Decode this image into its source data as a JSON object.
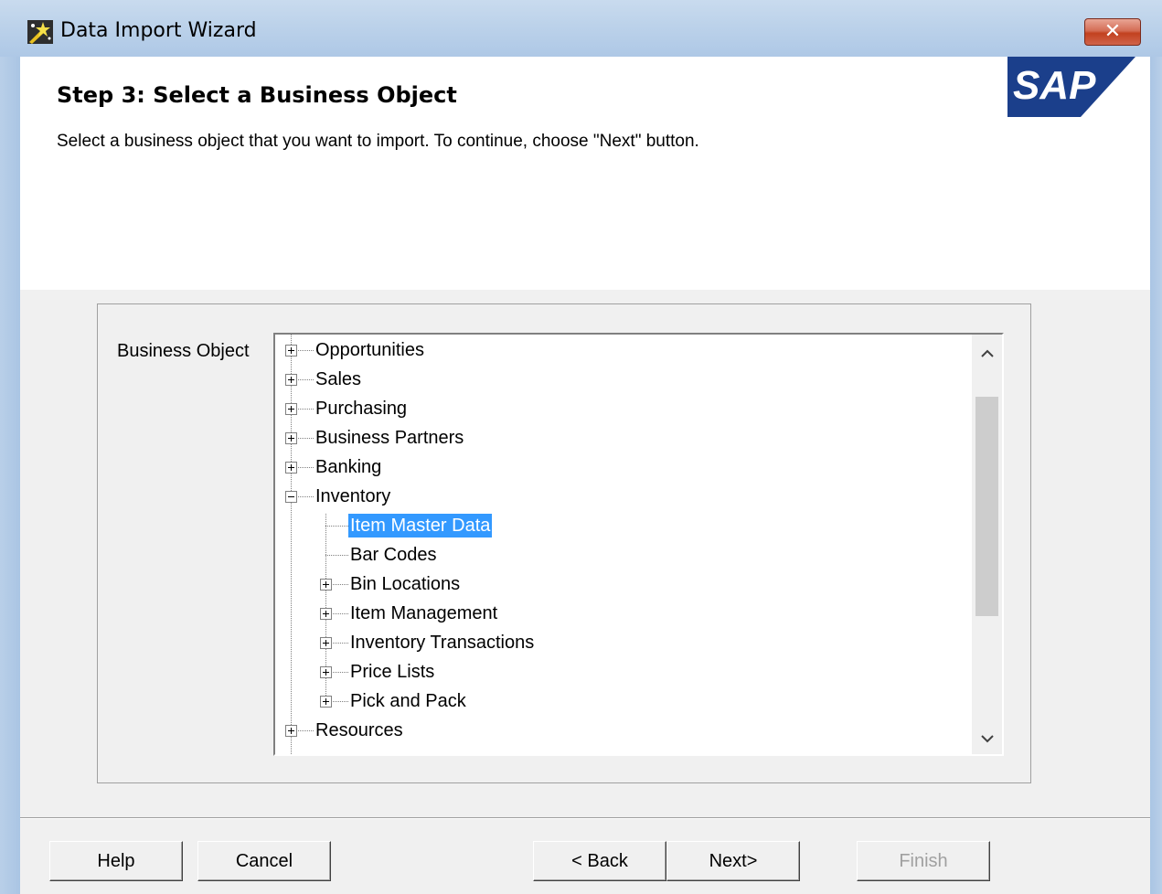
{
  "window": {
    "title": "Data Import Wizard",
    "close_label": "✕"
  },
  "header": {
    "step_title": "Step 3: Select a Business Object",
    "description": "Select a business object that you want to import. To continue, choose \"Next\" button.",
    "logo_text": "SAP"
  },
  "content": {
    "field_label": "Business Object",
    "tree": {
      "nodes": [
        {
          "label": "Opportunities",
          "state": "collapsed",
          "level": 0
        },
        {
          "label": "Sales",
          "state": "collapsed",
          "level": 0
        },
        {
          "label": "Purchasing",
          "state": "collapsed",
          "level": 0
        },
        {
          "label": "Business Partners",
          "state": "collapsed",
          "level": 0
        },
        {
          "label": "Banking",
          "state": "collapsed",
          "level": 0
        },
        {
          "label": "Inventory",
          "state": "expanded",
          "level": 0
        },
        {
          "label": "Item Master Data",
          "state": "leaf",
          "level": 1,
          "selected": true
        },
        {
          "label": "Bar Codes",
          "state": "leaf",
          "level": 1
        },
        {
          "label": "Bin Locations",
          "state": "collapsed",
          "level": 1
        },
        {
          "label": "Item Management",
          "state": "collapsed",
          "level": 1
        },
        {
          "label": "Inventory Transactions",
          "state": "collapsed",
          "level": 1
        },
        {
          "label": "Price Lists",
          "state": "collapsed",
          "level": 1
        },
        {
          "label": "Pick and Pack",
          "state": "collapsed",
          "level": 1
        },
        {
          "label": "Resources",
          "state": "collapsed",
          "level": 0
        }
      ]
    }
  },
  "footer": {
    "help_label": "Help",
    "cancel_label": "Cancel",
    "back_label": "< Back",
    "next_label": "Next>",
    "finish_label": "Finish"
  },
  "colors": {
    "selection": "#3399ff",
    "sap_blue": "#1b3f8b"
  },
  "icons": {
    "app": "wizard-icon",
    "close": "close-icon",
    "scroll_up": "chevron-up-icon",
    "scroll_down": "chevron-down-icon",
    "expand": "plus-box-icon",
    "collapse": "minus-box-icon"
  }
}
